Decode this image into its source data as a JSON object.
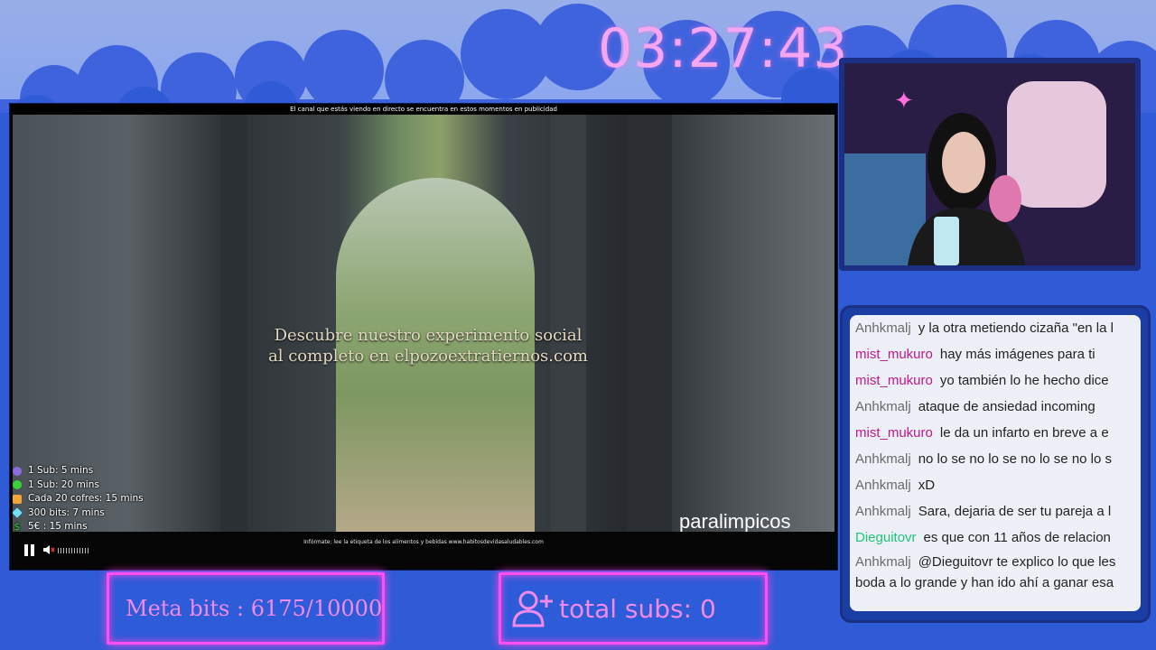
{
  "timer": "03:27:43",
  "player": {
    "ad_notice": "El canal que estás viendo en directo se encuentra en estos momentos en publicidad",
    "ad_text": [
      "Descubre nuestro experimento social",
      "al completo en elpozoextratiernos.com"
    ],
    "brand": "paralimpicos",
    "disclaimer": "Infórmate: lee la etiqueta de los alimentos y bebidas www.habitosdevidasaludables.com"
  },
  "legend": [
    {
      "icon": "purple-circle-icon",
      "color": "#8a6be0",
      "text": "1 Sub: 5 mins"
    },
    {
      "icon": "green-circle-icon",
      "color": "#3ad13a",
      "text": "1 Sub: 20 mins"
    },
    {
      "icon": "gift-chest-icon",
      "color": "#f0a63a",
      "text": "Cada 20 cofres: 15 mins"
    },
    {
      "icon": "diamond-icon",
      "color": "#6fe0ff",
      "text": "300 bits: 7 mins"
    },
    {
      "icon": "dollar-icon",
      "color": "#3ad13a",
      "text": "5€ : 15 mins"
    }
  ],
  "chat": [
    {
      "user": "Anhkmalj",
      "color": "#6a6a6a",
      "text": "y la otra metiendo cizaña \"en la l"
    },
    {
      "user": "mist_mukuro",
      "color": "#c2178e",
      "text": "hay más imágenes para ti"
    },
    {
      "user": "mist_mukuro",
      "color": "#c2178e",
      "text": "yo también lo he hecho dice"
    },
    {
      "user": "Anhkmalj",
      "color": "#6a6a6a",
      "text": "ataque de ansiedad incoming"
    },
    {
      "user": "mist_mukuro",
      "color": "#c2178e",
      "text": "le da un infarto en breve a e"
    },
    {
      "user": "Anhkmalj",
      "color": "#6a6a6a",
      "text": "no lo se no lo se no lo se no lo s"
    },
    {
      "user": "Anhkmalj",
      "color": "#6a6a6a",
      "text": "xD"
    },
    {
      "user": "Anhkmalj",
      "color": "#6a6a6a",
      "text": "Sara, dejaria de ser tu pareja a l"
    },
    {
      "user": "Dieguitovr",
      "color": "#1fc47a",
      "text": "es que con 11 años de relacion"
    },
    {
      "user": "Anhkmalj",
      "color": "#6a6a6a",
      "text": "@Dieguitovr te explico lo que les"
    }
  ],
  "chat_continuation": "boda a lo grande y han ido ahí a ganar esa",
  "meta_bits": "Meta bits : 6175/10000",
  "total_subs": "total subs: 0",
  "colors": {
    "accent": "#ff4ff0",
    "background": "#2f5cd6"
  }
}
